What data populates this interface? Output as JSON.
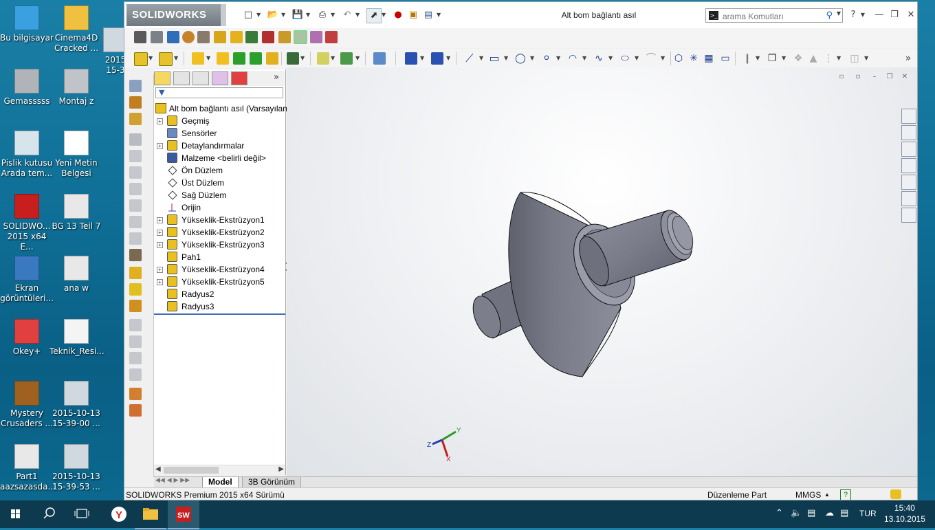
{
  "desktop": {
    "icons": [
      {
        "label": "Bu bilgisayar",
        "icon": "computer-icon"
      },
      {
        "label": "Cinema4D Cracked ...",
        "icon": "folder-icon"
      },
      {
        "label": "2015 15-3",
        "icon": "image-icon"
      },
      {
        "label": "Gemasssss",
        "icon": "drive-icon"
      },
      {
        "label": "Montaj z",
        "icon": "solidworks-assembly-icon"
      },
      {
        "label": "Pislik kutusu Arada tem...",
        "icon": "recycle-bin-icon"
      },
      {
        "label": "Yeni Metin Belgesi",
        "icon": "text-file-icon"
      },
      {
        "label": "SOLIDWO... 2015 x64 E...",
        "icon": "solidworks-icon"
      },
      {
        "label": "BG 13 Teil 7",
        "icon": "solidworks-part-icon"
      },
      {
        "label": "Ekran görüntüleri...",
        "icon": "screenshots-icon"
      },
      {
        "label": "ana w",
        "icon": "solidworks-part-icon"
      },
      {
        "label": "Okey+",
        "icon": "okey-icon"
      },
      {
        "label": "Teknik_Resi...",
        "icon": "pdf-icon"
      },
      {
        "label": "Mystery Crusaders ...",
        "icon": "game-icon"
      },
      {
        "label": "2015-10-13 15-39-00 ...",
        "icon": "image-icon"
      },
      {
        "label": "Part1 aazsazasda...",
        "icon": "solidworks-part-icon"
      },
      {
        "label": "2015-10-13 15-39-53 ...",
        "icon": "image-icon"
      }
    ]
  },
  "window": {
    "logo": "SOLIDWORKS",
    "title": "Alt bom bağlantı asıl",
    "search_placeholder": "arama Komutları",
    "help_label": "?"
  },
  "feature_tree": {
    "root": "Alt bom bağlantı asıl  (Varsayılan",
    "items": [
      {
        "label": "Geçmiş",
        "expandable": true,
        "icon": "history-icon"
      },
      {
        "label": "Sensörler",
        "expandable": false,
        "icon": "sensor-icon"
      },
      {
        "label": "Detaylandırmalar",
        "expandable": true,
        "icon": "annotations-icon"
      },
      {
        "label": "Malzeme <belirli değil>",
        "expandable": false,
        "icon": "material-icon"
      },
      {
        "label": "Ön Düzlem",
        "expandable": false,
        "icon": "plane-icon"
      },
      {
        "label": "Üst Düzlem",
        "expandable": false,
        "icon": "plane-icon"
      },
      {
        "label": "Sağ Düzlem",
        "expandable": false,
        "icon": "plane-icon"
      },
      {
        "label": "Orijin",
        "expandable": false,
        "icon": "origin-icon"
      },
      {
        "label": "Yükseklik-Ekstrüzyon1",
        "expandable": true,
        "icon": "extrude-icon"
      },
      {
        "label": "Yükseklik-Ekstrüzyon2",
        "expandable": true,
        "icon": "extrude-icon"
      },
      {
        "label": "Yükseklik-Ekstrüzyon3",
        "expandable": true,
        "icon": "extrude-icon"
      },
      {
        "label": "Pah1",
        "expandable": false,
        "icon": "chamfer-icon"
      },
      {
        "label": "Yükseklik-Ekstrüzyon4",
        "expandable": true,
        "icon": "extrude-icon"
      },
      {
        "label": "Yükseklik-Ekstrüzyon5",
        "expandable": true,
        "icon": "extrude-icon"
      },
      {
        "label": "Radyus2",
        "expandable": false,
        "icon": "fillet-icon"
      },
      {
        "label": "Radyus3",
        "expandable": false,
        "icon": "fillet-icon"
      }
    ]
  },
  "triad": {
    "x": "X",
    "y": "Y",
    "z": "Z"
  },
  "bottom_tabs": {
    "model": "Model",
    "view3d": "3B Görünüm"
  },
  "status": {
    "product": "SOLIDWORKS Premium 2015 x64 Sürümü",
    "mode": "Düzenleme Part",
    "units": "MMGS",
    "units_caret": "▲"
  },
  "taskbar": {
    "language": "TUR",
    "time": "15:40",
    "date": "13.10.2015"
  }
}
